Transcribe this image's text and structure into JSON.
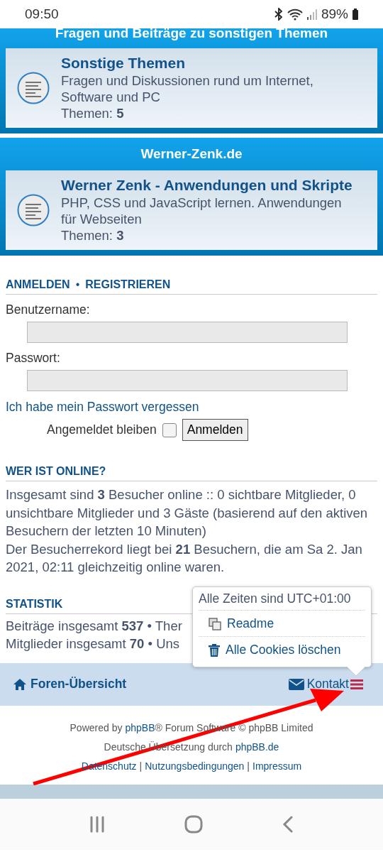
{
  "status_bar": {
    "time": "09:50",
    "battery": "89%"
  },
  "forums": [
    {
      "category": "Fragen und Beiträge zu sonstigen Themen",
      "title": "Sonstige Themen",
      "description": "Fragen und Diskussionen rund um Internet, Software und PC",
      "topics_label": "Themen:",
      "topics": "5"
    },
    {
      "category": "Werner-Zenk.de",
      "title": "Werner Zenk - Anwendungen und Skripte",
      "description": "PHP, CSS und JavaScript lernen. Anwendungen für Webseiten",
      "topics_label": "Themen:",
      "topics": "3"
    }
  ],
  "login": {
    "links": [
      "ANMELDEN",
      "REGISTRIEREN"
    ],
    "separator": "•",
    "username_label": "Benutzername:",
    "password_label": "Passwort:",
    "forgot_link": "Ich habe mein Passwort vergessen",
    "remember_label": "Angemeldet bleiben",
    "remember_checked": false,
    "submit": "Anmelden"
  },
  "online": {
    "heading": "WER IST ONLINE?",
    "paragraphs": [
      "Insgesamt sind **3** Besucher online :: 0 sichtbare Mitglieder, 0 unsichtbare Mitglieder und 3 Gäste (basierend auf den aktiven Besuchern der letzten 10 Minuten)",
      "Der Besucherrekord liegt bei **21** Besuchern, die am Sa 2. Jan 2021, 02:11 gleichzeitig online waren."
    ]
  },
  "stats": {
    "heading": "STATISTIK",
    "lines": [
      "Beiträge insgesamt **537** • Ther",
      "Mitglieder insgesamt **70** • Uns"
    ]
  },
  "footer_nav": {
    "home": "Foren-Übersicht",
    "contact": "Kontakt"
  },
  "popup": {
    "timezone": "Alle Zeiten sind UTC+01:00",
    "items": [
      {
        "kind": "copy",
        "label": "Readme"
      },
      {
        "kind": "trash",
        "label": "Alle Cookies löschen"
      }
    ]
  },
  "credits": [
    [
      {
        "kind": "text",
        "text": "Powered by"
      },
      {
        "kind": "link",
        "text": "phpBB"
      },
      {
        "kind": "text",
        "text": "® Forum Software © phpBB Limited",
        "tight": true
      }
    ],
    [
      {
        "kind": "text",
        "text": "Deutsche Übersetzung durch"
      },
      {
        "kind": "link",
        "text": "phpBB.de"
      }
    ],
    [
      {
        "kind": "link",
        "text": "Datenschutz"
      },
      {
        "kind": "text",
        "text": "|"
      },
      {
        "kind": "link",
        "text": "Nutzungsbedingungen"
      },
      {
        "kind": "text",
        "text": "|"
      },
      {
        "kind": "link",
        "text": "Impressum"
      }
    ]
  ]
}
